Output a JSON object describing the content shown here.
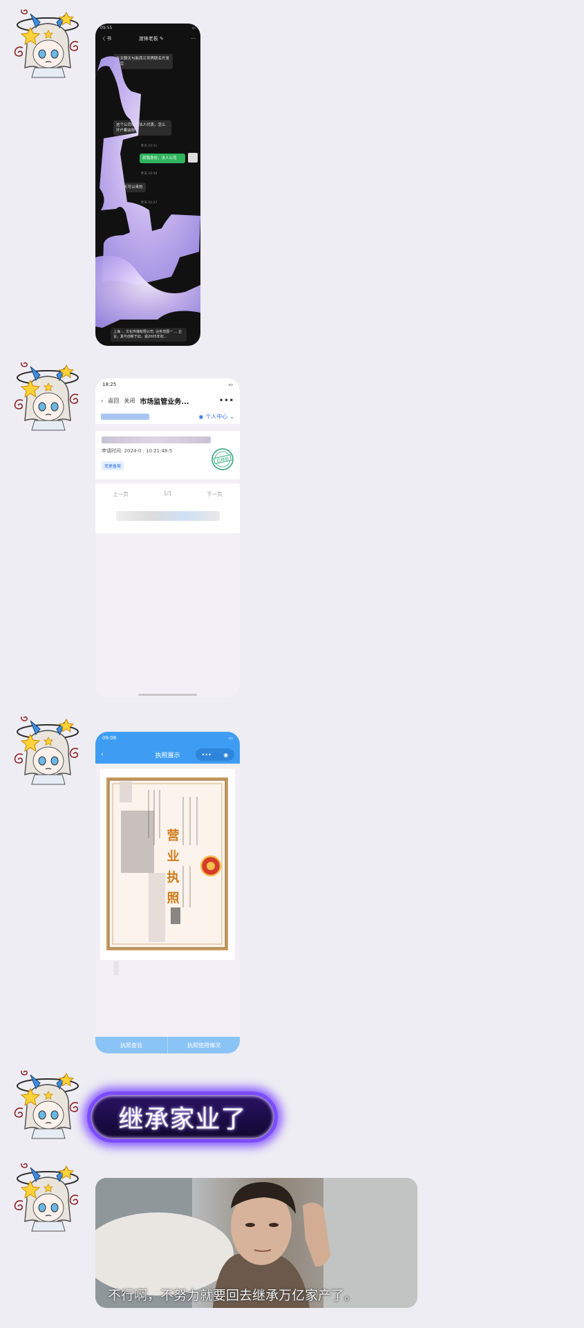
{
  "messages": [
    {
      "type": "screenshot",
      "status_time": "09:55",
      "nav_back": "〈 书",
      "nav_title": "渡锋老板 ✎",
      "nav_more": "···",
      "bubbles": [
        "今天聊天与新西兰世界联名开发会完",
        "这个公司你作法人代表，怎么开户都由你",
        "就我身份，法人公司",
        "这几天可以来的"
      ],
      "timestamps": [
        "昨天 22:11",
        "昨天 16:59",
        "昨天 22:27"
      ],
      "bottom_text": "上海 ... 文化传播有限公司, 业务范围一 ... 企业，其与创新于此，逾2005年初..."
    },
    {
      "type": "screenshot",
      "status_time": "18:25",
      "nav_back": "返回",
      "nav_close": "关闭",
      "nav_title": "市场监管业务...",
      "nav_more": "•••",
      "personal_center": "个人中心",
      "apply_time": "申请时间: 2024-0 . 10 21:48:5",
      "change_tag": "变更备案",
      "stamp_text": "已核验",
      "prev_page": "上一页",
      "page_indicator": "1/1",
      "next_page": "下一页"
    },
    {
      "type": "screenshot",
      "status_time": "09:08",
      "nav_title": "执照展示",
      "license_title": "营 业 执 照",
      "tab_left": "执照查验",
      "tab_right": "执照使用情况"
    },
    {
      "type": "sticker",
      "text": "继承家业了"
    },
    {
      "type": "image",
      "caption": "不行啊，不努力就要回去继承万亿家产了。"
    }
  ]
}
